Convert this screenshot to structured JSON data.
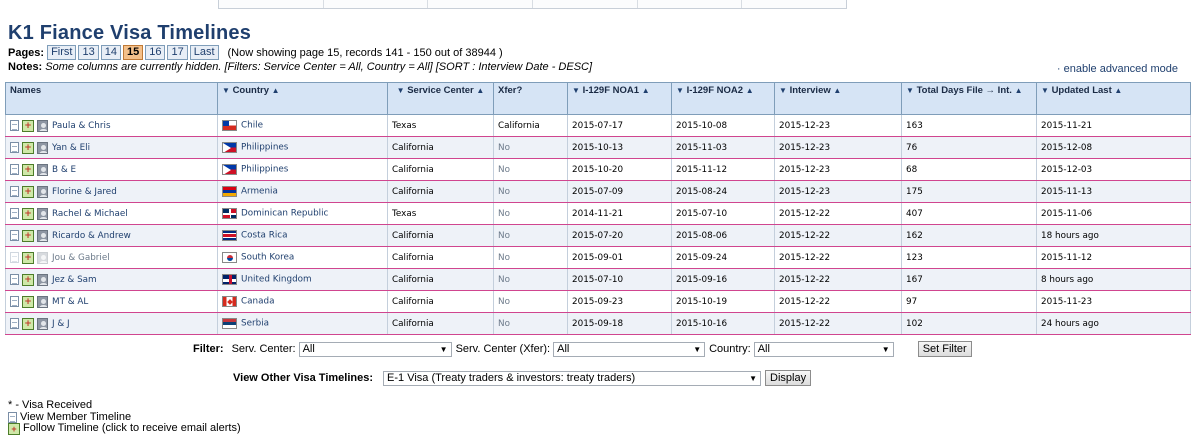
{
  "page": {
    "title": "K1 Fiance Visa Timelines",
    "pages_label": "Pages:",
    "page_buttons": [
      "First",
      "13",
      "14",
      "15",
      "16",
      "17",
      "Last"
    ],
    "current_page": "15",
    "showing_text": "(Now showing page 15, records 141 - 150 out of 38944 )",
    "notes_label": "Notes:",
    "notes_text": "Some columns are currently hidden. [Filters: Service Center = All, Country = All] [SORT : Interview Date - DESC]",
    "advanced_link": "· enable advanced mode"
  },
  "table": {
    "headers": [
      {
        "label": "Names"
      },
      {
        "label": "Country"
      },
      {
        "label": "Service Center"
      },
      {
        "label": "Xfer?"
      },
      {
        "label": "I-129F NOA1"
      },
      {
        "label": "I-129F NOA2"
      },
      {
        "label": "Interview"
      },
      {
        "label": "Total Days File → Int."
      },
      {
        "label": "Updated Last"
      }
    ],
    "rows": [
      {
        "name": "Paula & Chris",
        "country": "Chile",
        "service_center": "Texas",
        "xfer": "California",
        "noa1": "2015-07-17",
        "noa2": "2015-10-08",
        "interview": "2015-12-23",
        "total_days": "163",
        "updated": "2015-11-21"
      },
      {
        "name": "Yan & Eli",
        "country": "Philippines",
        "service_center": "California",
        "xfer": "No",
        "noa1": "2015-10-13",
        "noa2": "2015-11-03",
        "interview": "2015-12-23",
        "total_days": "76",
        "updated": "2015-12-08"
      },
      {
        "name": "B & E",
        "country": "Philippines",
        "service_center": "California",
        "xfer": "No",
        "noa1": "2015-10-20",
        "noa2": "2015-11-12",
        "interview": "2015-12-23",
        "total_days": "68",
        "updated": "2015-12-03"
      },
      {
        "name": "Florine & Jared",
        "country": "Armenia",
        "service_center": "California",
        "xfer": "No",
        "noa1": "2015-07-09",
        "noa2": "2015-08-24",
        "interview": "2015-12-23",
        "total_days": "175",
        "updated": "2015-11-13"
      },
      {
        "name": "Rachel & Michael",
        "country": "Dominican Republic",
        "service_center": "Texas",
        "xfer": "No",
        "noa1": "2014-11-21",
        "noa2": "2015-07-10",
        "interview": "2015-12-22",
        "total_days": "407",
        "updated": "2015-11-06"
      },
      {
        "name": "Ricardo & Andrew",
        "country": "Costa Rica",
        "service_center": "California",
        "xfer": "No",
        "noa1": "2015-07-20",
        "noa2": "2015-08-06",
        "interview": "2015-12-22",
        "total_days": "162",
        "updated": "18 hours ago"
      },
      {
        "name": "Jou & Gabriel",
        "country": "South Korea",
        "service_center": "California",
        "xfer": "No",
        "noa1": "2015-09-01",
        "noa2": "2015-09-24",
        "interview": "2015-12-22",
        "total_days": "123",
        "updated": "2015-11-12"
      },
      {
        "name": "Jez & Sam",
        "country": "United Kingdom",
        "service_center": "California",
        "xfer": "No",
        "noa1": "2015-07-10",
        "noa2": "2015-09-16",
        "interview": "2015-12-22",
        "total_days": "167",
        "updated": "8 hours ago"
      },
      {
        "name": "MT & AL",
        "country": "Canada",
        "service_center": "California",
        "xfer": "No",
        "noa1": "2015-09-23",
        "noa2": "2015-10-19",
        "interview": "2015-12-22",
        "total_days": "97",
        "updated": "2015-11-23"
      },
      {
        "name": "J & J",
        "country": "Serbia",
        "service_center": "California",
        "xfer": "No",
        "noa1": "2015-09-18",
        "noa2": "2015-10-16",
        "interview": "2015-12-22",
        "total_days": "102",
        "updated": "24 hours ago"
      }
    ]
  },
  "filter": {
    "label": "Filter:",
    "serv_center_label": "Serv. Center:",
    "serv_center_value": "All",
    "xfer_label": "Serv. Center (Xfer):",
    "xfer_value": "All",
    "country_label": "Country:",
    "country_value": "All",
    "set_button": "Set Filter"
  },
  "other": {
    "label": "View Other Visa Timelines:",
    "value": "E-1 Visa (Treaty traders & investors: treaty traders)",
    "display_button": "Display"
  },
  "legend": {
    "visa_received": "* - Visa Received",
    "view_member": "View Member Timeline",
    "follow": "Follow Timeline (click to receive email alerts)"
  },
  "icons": {
    "sort_down": "▼",
    "sort_up": "▲",
    "select_arrow": "▼"
  },
  "colors": {
    "title": "#1f3f6e",
    "header_bg": "#d6e4f5",
    "row_alt": "#eef2f8",
    "row_border": "#d0458f",
    "current_page_bg": "#f4c08a"
  }
}
